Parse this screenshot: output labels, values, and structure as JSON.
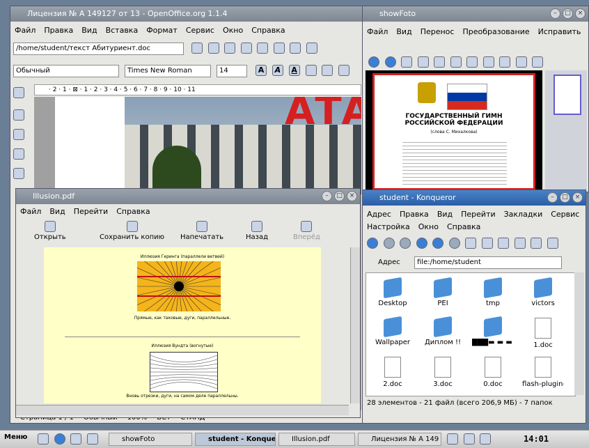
{
  "writer": {
    "title": "Лицензия № А 149127 от 13 - OpenOffice.org 1.1.4",
    "menu": [
      "Файл",
      "Правка",
      "Вид",
      "Вставка",
      "Формат",
      "Сервис",
      "Окно",
      "Справка"
    ],
    "path": "/home/student/текст Абитуриент.doc",
    "style": "Обычный",
    "font": "Times New Roman",
    "size": "14",
    "bold": "A",
    "italic": "A",
    "underline": "A",
    "ruler": "· 2 · 1 · ⊠ · 1 · 2 · 3 · 4 · 5 · 6 · 7 · 8 · 9 · 10 · 11",
    "banner": "АТА",
    "status": [
      "Страница 1 / 1",
      "Обычный",
      "100%",
      "ВСТ",
      "СТАНД",
      "*"
    ]
  },
  "show": {
    "title": "showFoto",
    "menu": [
      "Файл",
      "Вид",
      "Перенос",
      "Преобразование",
      "Исправить",
      "Справка"
    ],
    "doc_title": "ГОСУДАРСТВЕННЫЙ ГИМН РОССИЙСКОЙ ФЕДЕРАЦИИ",
    "doc_sub": "(слова С. Михалкова)"
  },
  "pdf": {
    "title": "Illusion.pdf",
    "menu": [
      "Файл",
      "Вид",
      "Перейти",
      "Справка"
    ],
    "tools": [
      "Открыть",
      "Сохранить копию",
      "Напечатать",
      "Назад",
      "Вперёд"
    ],
    "fig1_title": "Иллюзия Геринга (параллели ветвей)",
    "fig1_caption": "Прямые, как таковые, дуги, параллельные.",
    "fig2_title": "Иллюзия Вундта (вогнутые)",
    "fig2_caption": "Вновь отрезки, дуги, на самом деле параллельны."
  },
  "konq": {
    "title": "student - Konqueror",
    "menu1": [
      "Адрес",
      "Правка",
      "Вид",
      "Перейти",
      "Закладки",
      "Сервис"
    ],
    "menu2": [
      "Настройка",
      "Окно",
      "Справка"
    ],
    "addr_label": "Адрес",
    "addr": "file:/home/student",
    "files": [
      {
        "name": "Desktop",
        "kind": "folder"
      },
      {
        "name": "PEI",
        "kind": "folder"
      },
      {
        "name": "tmp",
        "kind": "folder"
      },
      {
        "name": "victors",
        "kind": "folder"
      },
      {
        "name": "Wallpaper",
        "kind": "folder"
      },
      {
        "name": "Диплом !!",
        "kind": "folder"
      },
      {
        "name": "███▬ ▬ ▬ ▬ ▬ ▬ рО..",
        "kind": "folder"
      },
      {
        "name": "1.doc",
        "kind": "doc"
      },
      {
        "name": "2.doc",
        "kind": "doc"
      },
      {
        "name": "3.doc",
        "kind": "doc"
      },
      {
        "name": "0.doc",
        "kind": "doc"
      },
      {
        "name": "flash-plugin-",
        "kind": "doc"
      }
    ],
    "status": "28 элементов - 21 файл (всего 206,9 МБ) - 7 папок"
  },
  "taskbar": {
    "start": "Меню",
    "tasks": [
      "showFoto",
      "student - Konqueror",
      "Illusion.pdf",
      "Лицензия № А 149"
    ],
    "clock": "14:01"
  },
  "colors": {
    "accent": "#2a5ea8",
    "flag_red": "#d52b1e",
    "flag_blue": "#0039a6",
    "pdf_bg": "#ffffc8"
  }
}
